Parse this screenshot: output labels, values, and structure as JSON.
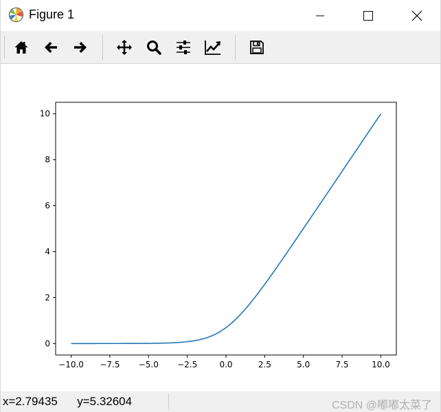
{
  "window": {
    "title": "Figure 1",
    "minimize_icon": "minimize-icon",
    "maximize_icon": "maximize-icon",
    "close_icon": "close-icon"
  },
  "toolbar": {
    "buttons": [
      {
        "name": "home",
        "icon": "home-icon"
      },
      {
        "name": "back",
        "icon": "arrow-left-icon"
      },
      {
        "name": "forward",
        "icon": "arrow-right-icon"
      },
      {
        "name": "pan",
        "icon": "move-icon"
      },
      {
        "name": "zoom",
        "icon": "magnifier-icon"
      },
      {
        "name": "configure-subplots",
        "icon": "sliders-icon"
      },
      {
        "name": "edit-axis",
        "icon": "line-chart-icon"
      },
      {
        "name": "save",
        "icon": "floppy-disk-icon"
      }
    ]
  },
  "status": {
    "text": "x=2.79435      y=5.32604"
  },
  "watermark": {
    "text": "CSDN @嘟嘟太菜了"
  },
  "colors": {
    "line": "#1f77b4",
    "toolbar_bg": "#f0f0f0",
    "statusbar_bg": "#f0f0f0"
  },
  "chart_data": {
    "type": "line",
    "function": "softplus",
    "title": "",
    "xlabel": "",
    "ylabel": "",
    "xlim": [
      -11.0,
      11.0
    ],
    "ylim": [
      -0.5,
      10.5
    ],
    "xticks": [
      -10.0,
      -7.5,
      -5.0,
      -2.5,
      0.0,
      2.5,
      5.0,
      7.5,
      10.0
    ],
    "xtick_labels": [
      "−10.0",
      "−7.5",
      "−5.0",
      "−2.5",
      "0.0",
      "2.5",
      "5.0",
      "7.5",
      "10.0"
    ],
    "yticks": [
      0,
      2,
      4,
      6,
      8,
      10
    ],
    "ytick_labels": [
      "0",
      "2",
      "4",
      "6",
      "8",
      "10"
    ],
    "grid": false,
    "series": [
      {
        "x": [
          -10,
          -9,
          -8,
          -7,
          -6,
          -5,
          -4,
          -3,
          -2.5,
          -2,
          -1.5,
          -1,
          -0.5,
          0,
          0.5,
          1,
          1.5,
          2,
          2.5,
          3,
          3.5,
          4,
          4.5,
          5,
          6,
          7,
          8,
          9,
          10
        ],
        "y": [
          4.54e-05,
          0.000123,
          0.000335,
          0.000911,
          0.00248,
          0.00672,
          0.0181,
          0.0486,
          0.0789,
          0.127,
          0.201,
          0.313,
          0.474,
          0.693,
          0.974,
          1.313,
          1.701,
          2.127,
          2.579,
          3.049,
          3.53,
          4.018,
          4.511,
          5.007,
          6.002,
          7.001,
          8.0,
          9.0,
          10.0
        ]
      }
    ]
  }
}
